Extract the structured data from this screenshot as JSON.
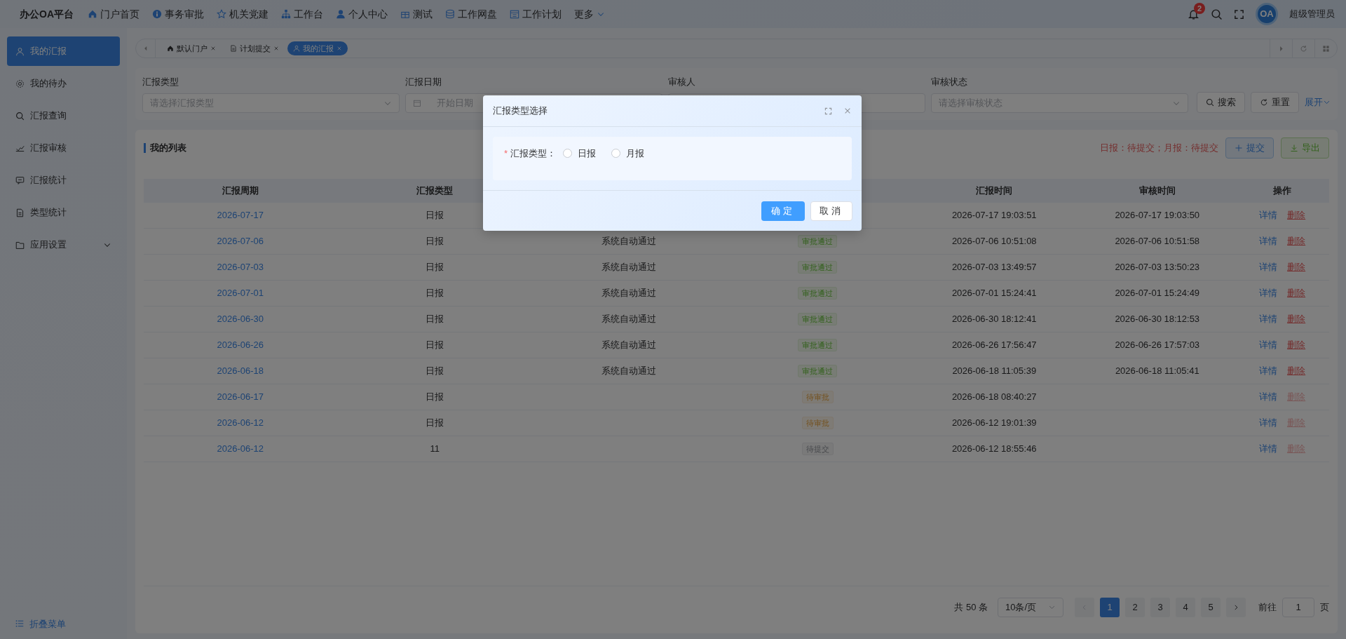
{
  "app": {
    "title": "办公OA平台"
  },
  "top_nav": [
    {
      "label": "门户首页"
    },
    {
      "label": "事务审批"
    },
    {
      "label": "机关党建"
    },
    {
      "label": "工作台"
    },
    {
      "label": "个人中心"
    },
    {
      "label": "测试"
    },
    {
      "label": "工作网盘"
    },
    {
      "label": "工作计划"
    },
    {
      "label": "更多"
    }
  ],
  "header": {
    "notification_count": "2",
    "avatar_text": "OA",
    "user": "超级管理员"
  },
  "sidebar": {
    "items": [
      {
        "label": "我的汇报",
        "selected": true
      },
      {
        "label": "我的待办",
        "selected": false
      },
      {
        "label": "汇报查询",
        "selected": false
      },
      {
        "label": "汇报审核",
        "selected": false
      },
      {
        "label": "汇报统计",
        "selected": false
      },
      {
        "label": "类型统计",
        "selected": false
      },
      {
        "label": "应用设置",
        "selected": false,
        "expanded": false
      }
    ],
    "collapse": "折叠菜单"
  },
  "page_tabs": [
    {
      "label": "默认门户",
      "selected": false
    },
    {
      "label": "计划提交",
      "selected": false
    },
    {
      "label": "我的汇报",
      "selected": true
    }
  ],
  "filters": [
    {
      "label": "汇报类型",
      "kind": "select",
      "placeholder": "请选择汇报类型"
    },
    {
      "label": "汇报日期",
      "kind": "daterange",
      "placeholder": "开始日期"
    },
    {
      "label": "审核人",
      "kind": "input"
    },
    {
      "label": "审核状态",
      "kind": "select",
      "placeholder": "请选择审核状态"
    }
  ],
  "filter_buttons": {
    "search": "搜索",
    "reset": "重置",
    "expand": "展开"
  },
  "list": {
    "title": "我的列表",
    "notice": "日报：待提交；月报：待提交",
    "submit": "提交",
    "export": "导出",
    "columns": [
      "汇报周期",
      "汇报类型",
      null,
      null,
      "汇报时间",
      "审核时间",
      "操作"
    ],
    "rows": [
      {
        "period": "2026-07-17",
        "type": "日报",
        "report_time": "2026-07-17 19:03:51",
        "review_time": "2026-07-17 19:03:50",
        "detail": "详情",
        "delete": "删除",
        "delete_disabled": false
      },
      {
        "period": "2026-07-06",
        "type": "日报",
        "column_3": "系统自动通过",
        "status": {
          "label": "审批通过",
          "kind": "approved"
        },
        "report_time": "2026-07-06 10:51:08",
        "review_time": "2026-07-06 10:51:58",
        "detail": "详情",
        "delete": "删除",
        "delete_disabled": false
      },
      {
        "period": "2026-07-03",
        "type": "日报",
        "column_3": "系统自动通过",
        "status": {
          "label": "审批通过",
          "kind": "approved"
        },
        "report_time": "2026-07-03 13:49:57",
        "review_time": "2026-07-03 13:50:23",
        "detail": "详情",
        "delete": "删除",
        "delete_disabled": false
      },
      {
        "period": "2026-07-01",
        "type": "日报",
        "column_3": "系统自动通过",
        "status": {
          "label": "审批通过",
          "kind": "approved"
        },
        "report_time": "2026-07-01 15:24:41",
        "review_time": "2026-07-01 15:24:49",
        "detail": "详情",
        "delete": "删除",
        "delete_disabled": false
      },
      {
        "period": "2026-06-30",
        "type": "日报",
        "column_3": "系统自动通过",
        "status": {
          "label": "审批通过",
          "kind": "approved"
        },
        "report_time": "2026-06-30 18:12:41",
        "review_time": "2026-06-30 18:12:53",
        "detail": "详情",
        "delete": "删除",
        "delete_disabled": false
      },
      {
        "period": "2026-06-26",
        "type": "日报",
        "column_3": "系统自动通过",
        "status": {
          "label": "审批通过",
          "kind": "approved"
        },
        "report_time": "2026-06-26 17:56:47",
        "review_time": "2026-06-26 17:57:03",
        "detail": "详情",
        "delete": "删除",
        "delete_disabled": false
      },
      {
        "period": "2026-06-18",
        "type": "日报",
        "column_3": "系统自动通过",
        "status": {
          "label": "审批通过",
          "kind": "approved"
        },
        "report_time": "2026-06-18 11:05:39",
        "review_time": "2026-06-18 11:05:41",
        "detail": "详情",
        "delete": "删除",
        "delete_disabled": false
      },
      {
        "period": "2026-06-17",
        "type": "日报",
        "status": {
          "label": "待审批",
          "kind": "pending"
        },
        "report_time": "2026-06-18 08:40:27",
        "detail": "详情",
        "delete": "删除",
        "delete_disabled": true
      },
      {
        "period": "2026-06-12",
        "type": "日报",
        "status": {
          "label": "待审批",
          "kind": "pending"
        },
        "report_time": "2026-06-12 19:01:39",
        "detail": "详情",
        "delete": "删除",
        "delete_disabled": true
      },
      {
        "period": "2026-06-12",
        "type": "11",
        "status": {
          "label": "待提交",
          "kind": "draft"
        },
        "report_time": "2026-06-12 18:55:46",
        "detail": "详情",
        "delete": "删除",
        "delete_disabled": true
      }
    ]
  },
  "pagination": {
    "total": "共 50 条",
    "page_size": "10条/页",
    "pages": [
      {
        "label": "1",
        "selected": true
      },
      {
        "label": "2",
        "selected": false
      },
      {
        "label": "3",
        "selected": false
      },
      {
        "label": "4",
        "selected": false
      },
      {
        "label": "5",
        "selected": false
      }
    ],
    "goto_label": "前往",
    "goto_value": "1",
    "goto_suffix": "页"
  },
  "modal": {
    "title": "汇报类型选择",
    "field_label": "汇报类型：",
    "required_mark": "*",
    "options": [
      {
        "label": "日报",
        "selected": false
      },
      {
        "label": "月报",
        "selected": false
      }
    ],
    "ok": "确定",
    "cancel": "取消"
  }
}
